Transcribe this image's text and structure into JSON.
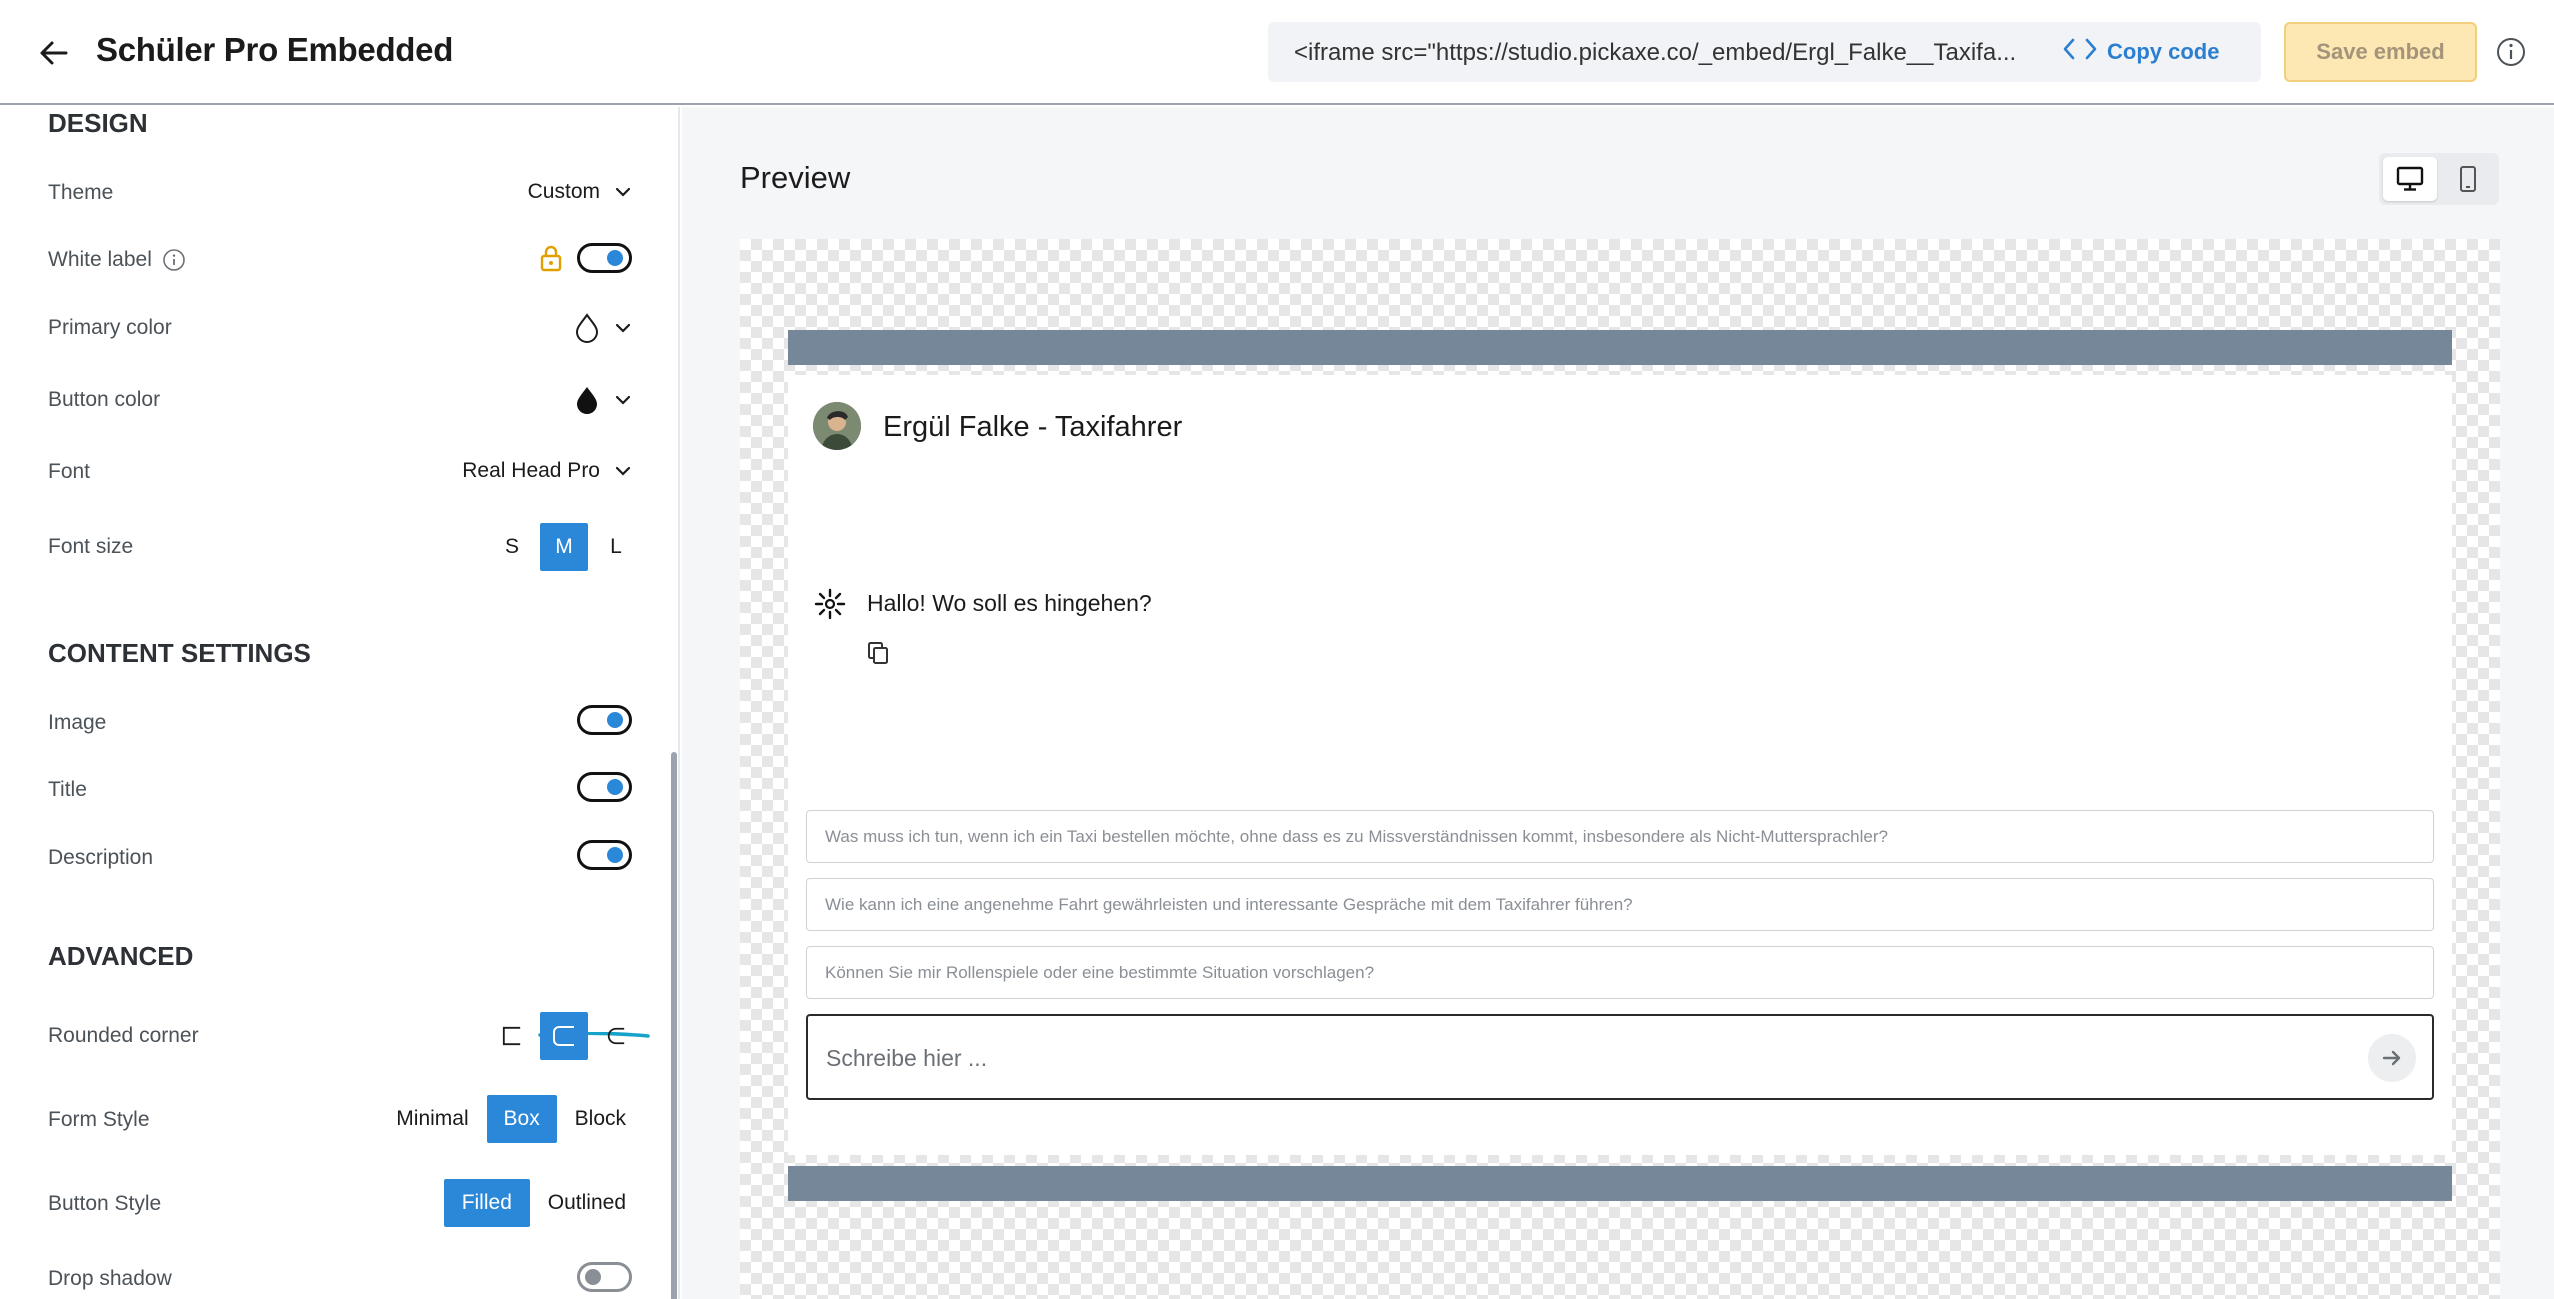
{
  "header": {
    "title": "Schüler Pro Embedded",
    "embed_code": "<iframe src=\"https://studio.pickaxe.co/_embed/Ergl_Falke__Taxifa...",
    "copy_code_label": "Copy code",
    "save_embed_label": "Save embed"
  },
  "sidebar": {
    "design": {
      "title": "DESIGN",
      "theme_label": "Theme",
      "theme_value": "Custom",
      "white_label_label": "White label",
      "white_label_on": true,
      "primary_color_label": "Primary color",
      "button_color_label": "Button color",
      "font_label": "Font",
      "font_value": "Real Head Pro",
      "font_size_label": "Font size",
      "font_size_options": [
        "S",
        "M",
        "L"
      ],
      "font_size_selected": "M"
    },
    "content": {
      "title": "CONTENT SETTINGS",
      "image_label": "Image",
      "image_on": true,
      "title_label": "Title",
      "title_on": true,
      "description_label": "Description",
      "description_on": true
    },
    "advanced": {
      "title": "ADVANCED",
      "rounded_corner_label": "Rounded corner",
      "rounded_corner_selected": "medium",
      "form_style_label": "Form Style",
      "form_style_options": [
        "Minimal",
        "Box",
        "Block"
      ],
      "form_style_selected": "Box",
      "button_style_label": "Button Style",
      "button_style_options": [
        "Filled",
        "Outlined"
      ],
      "button_style_selected": "Filled",
      "drop_shadow_label": "Drop shadow",
      "drop_shadow_on": false
    }
  },
  "preview": {
    "title": "Preview",
    "device_selected": "desktop",
    "chat": {
      "name": "Ergül Falke - Taxifahrer",
      "bot_message": "Hallo! Wo soll es hingehen?",
      "suggestions": [
        "Was muss ich tun, wenn ich ein Taxi bestellen möchte, ohne dass es zu Missverständnissen kommt, insbesondere als Nicht-Muttersprachler?",
        "Wie kann ich eine angenehme Fahrt gewährleisten und interessante Gespräche mit dem Taxifahrer führen?",
        "Können Sie mir Rollenspiele oder eine bestimmte Situation vorschlagen?"
      ],
      "input_placeholder": "Schreibe hier ..."
    }
  },
  "colors": {
    "accent": "#2b87d8",
    "save_button_bg": "#fde7b3",
    "bar": "#77879a",
    "lock": "#e0a100",
    "annotation": "#17a2c9"
  }
}
